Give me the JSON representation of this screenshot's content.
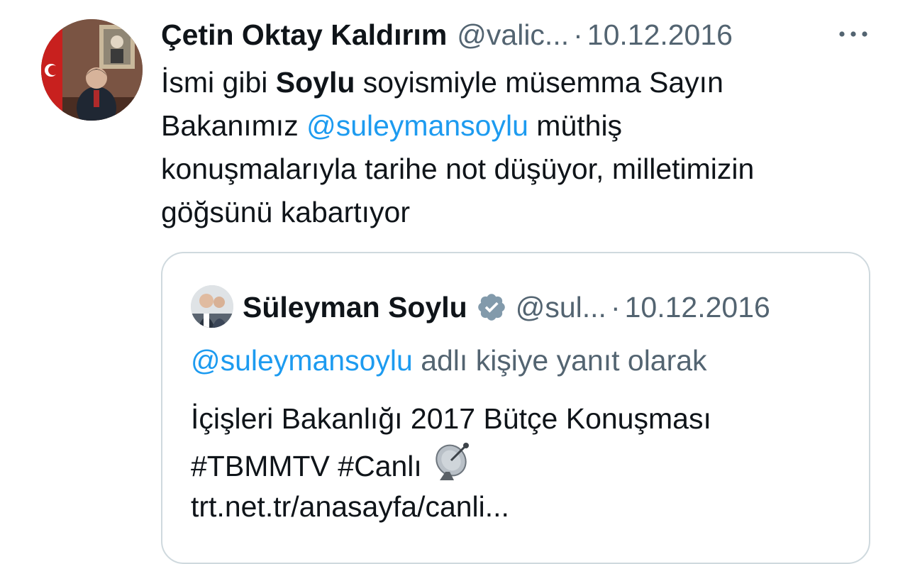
{
  "tweet": {
    "author_name": "Çetin Oktay Kaldırım",
    "handle": "@valic...",
    "separator": "·",
    "date": "10.12.2016",
    "more_icon": "more-icon",
    "text": {
      "l1_pre": "İsmi gibi ",
      "l1_bold": "Soylu",
      "l1_post": " soyismiyle müsemma Sayın",
      "l2_pre": "Bakanımız ",
      "l2_mention": "@suleymansoylu",
      "l2_post": " müthiş",
      "l3": "konuşmalarıyla tarihe not düşüyor, milletimizin",
      "l4": "göğsünü kabartıyor"
    }
  },
  "quote": {
    "author_name": "Süleyman Soylu",
    "verified_icon": "verified-badge-icon",
    "handle": "@sul...",
    "separator": "·",
    "date": "10.12.2016",
    "reply_mention": "@suleymansoylu",
    "reply_text": " adlı kişiye yanıt olarak",
    "text": {
      "l1": "İçişleri Bakanlığı 2017 Bütçe Konuşması",
      "l2": "#TBMMTV #Canlı ",
      "l2_icon": "satellite-antenna-icon",
      "l3": "trt.net.tr/anasayfa/canli..."
    }
  },
  "colors": {
    "link": "#1d9bf0",
    "secondary": "#536471",
    "text": "#0f1419",
    "border": "#cfd9de",
    "verified": "#829aab"
  }
}
